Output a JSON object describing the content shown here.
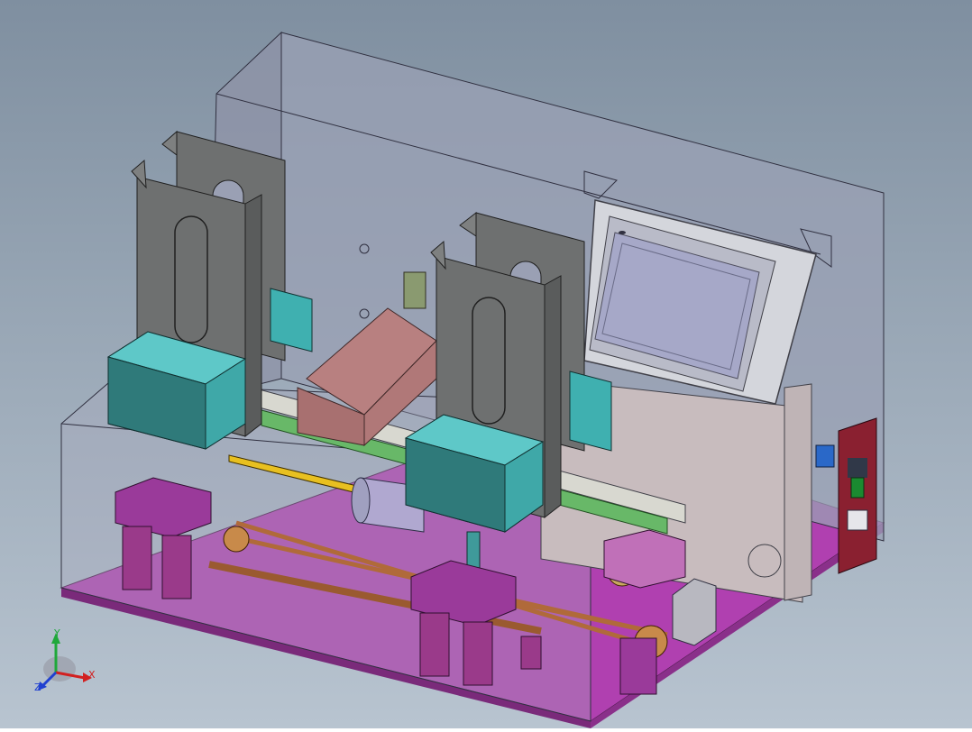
{
  "viewport": {
    "background_top": "#7f8fa0",
    "background_bottom": "#b8c4d0"
  },
  "triad": {
    "axis_x_label": "X",
    "axis_y_label": "Y",
    "axis_z_label": "Z",
    "x_color": "#d22020",
    "y_color": "#1fa83a",
    "z_color": "#2040d0"
  },
  "colors": {
    "enclosure": "#9aa0b4",
    "base_plate": "#b040b0",
    "hopper_grey": "#6e7070",
    "teal_block": "#3fb0b0",
    "rose_roller": "#b88080",
    "copper": "#b06a3a",
    "screen_bezel": "#d4d6dc",
    "screen_display": "#a6a8c8",
    "power_module": "#8a2030"
  }
}
